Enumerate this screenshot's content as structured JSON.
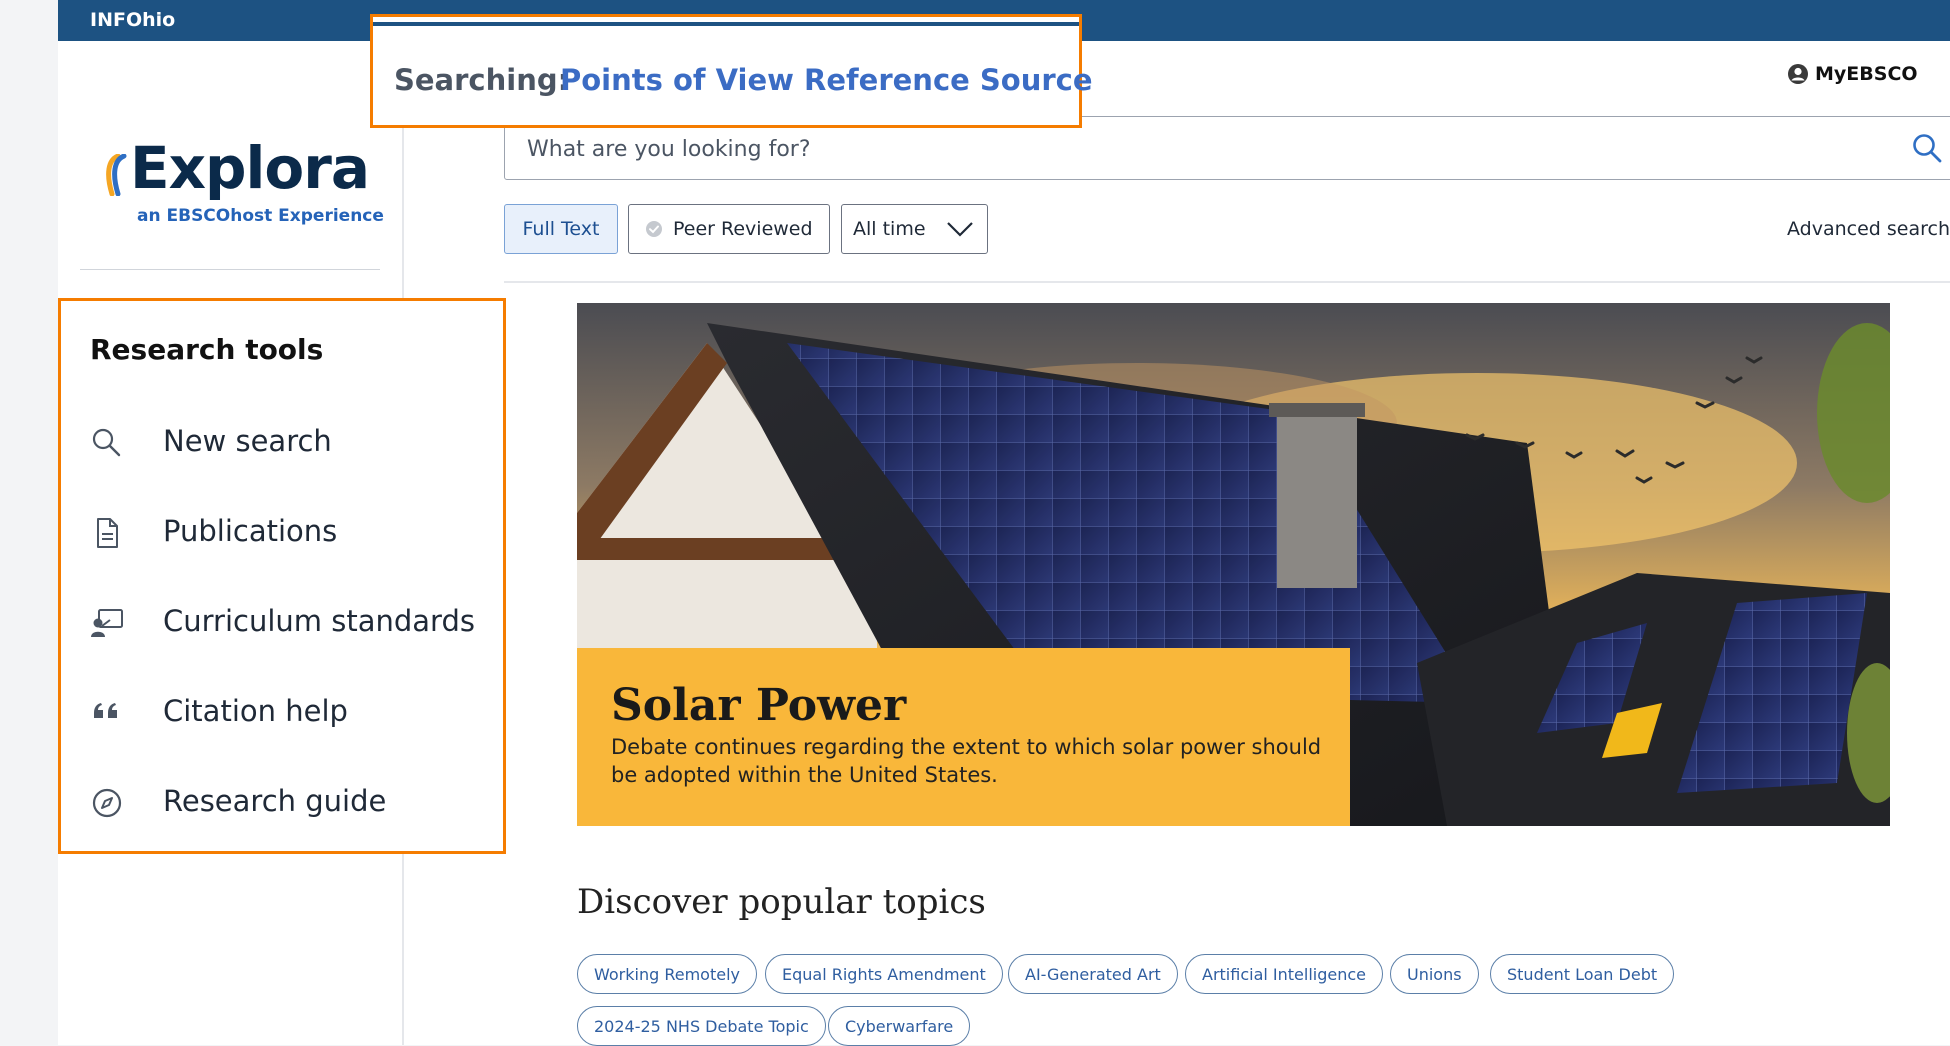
{
  "topbar": {
    "brand": "INFOhio"
  },
  "logo": {
    "word": "Explora",
    "subtitle": "an EBSCOhost Experience"
  },
  "search_context": {
    "label": "Searching:",
    "database": "Points of View Reference Source"
  },
  "account": {
    "label": "MyEBSCO",
    "icon": "user-circle-icon"
  },
  "search": {
    "placeholder": "What are you looking for?",
    "icon": "search-icon"
  },
  "filters": {
    "full_text": "Full Text",
    "peer_reviewed": "Peer Reviewed",
    "time": "All time",
    "advanced": "Advanced search"
  },
  "research_tools": {
    "title": "Research tools",
    "items": [
      {
        "label": "New search",
        "icon": "search-icon"
      },
      {
        "label": "Publications",
        "icon": "document-icon"
      },
      {
        "label": "Curriculum standards",
        "icon": "teacher-board-icon"
      },
      {
        "label": "Citation help",
        "icon": "quote-icon"
      },
      {
        "label": "Research guide",
        "icon": "compass-icon"
      }
    ]
  },
  "hero": {
    "title": "Solar Power",
    "description": "Debate continues regarding the extent to which solar power should be adopted within the United States."
  },
  "discover": {
    "title": "Discover popular topics",
    "topics": [
      "Working Remotely",
      "Equal Rights Amendment",
      "AI-Generated Art",
      "Artificial Intelligence",
      "Unions",
      "Student Loan Debt",
      "2024-25 NHS Debate Topic",
      "Cyberwarfare"
    ]
  },
  "colors": {
    "topbar": "#1d5282",
    "highlight_border": "#f57c00",
    "link_blue": "#3b6cc4",
    "hero_card": "#f9b73a"
  }
}
